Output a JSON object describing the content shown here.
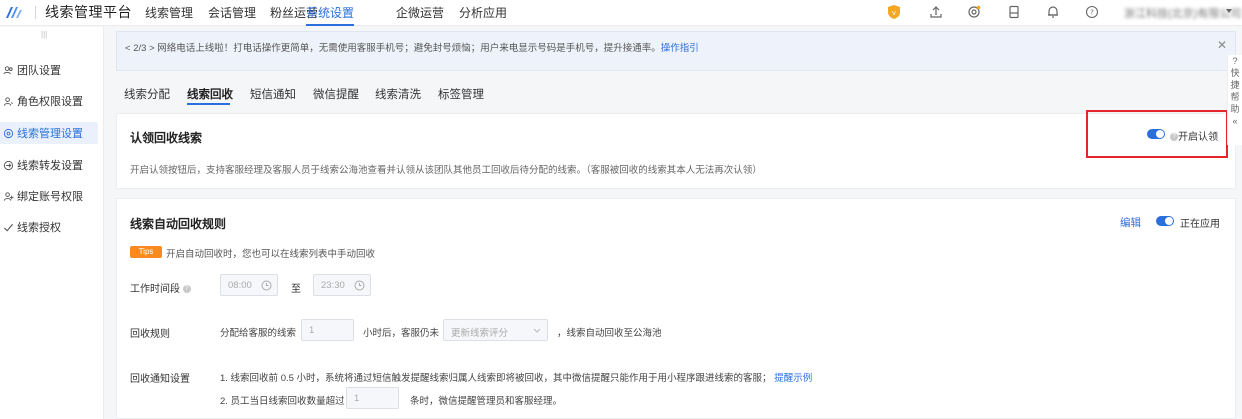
{
  "app": {
    "title": "线索管理平台",
    "user_name": "浙江科技(北京)有限公司"
  },
  "nav": {
    "items": [
      {
        "label": "线索管理"
      },
      {
        "label": "会话管理"
      },
      {
        "label": "粉丝运营"
      },
      {
        "label": "系统设置"
      },
      {
        "label": "企微运营"
      },
      {
        "label": "分析应用"
      }
    ],
    "active_index": 3
  },
  "sidebar": {
    "items": [
      {
        "label": "团队设置",
        "icon": "team-icon"
      },
      {
        "label": "角色权限设置",
        "icon": "user-role-icon"
      },
      {
        "label": "线索管理设置",
        "icon": "clue-settings-icon"
      },
      {
        "label": "线索转发设置",
        "icon": "forward-icon"
      },
      {
        "label": "绑定账号权限",
        "icon": "bind-account-icon"
      },
      {
        "label": "线索授权",
        "icon": "authorize-icon"
      }
    ],
    "active_index": 2
  },
  "notice": {
    "pager": "2/3",
    "text": "网络电话上线啦！打电话操作更简单，无需使用客服手机号；避免封号烦恼；用户来电显示号码是手机号，提升接通率。",
    "link": "操作指引"
  },
  "tabs": {
    "items": [
      {
        "label": "线索分配"
      },
      {
        "label": "线索回收"
      },
      {
        "label": "短信通知"
      },
      {
        "label": "微信提醒"
      },
      {
        "label": "线索清洗"
      },
      {
        "label": "标签管理"
      }
    ],
    "active_index": 1
  },
  "claim_card": {
    "title": "认领回收线索",
    "toggle_label": "开启认领",
    "toggle_on": true,
    "description": "开启认领按钮后，支持客服经理及客服人员于线索公海池查看并认领从该团队其他员工回收后待分配的线索。（客服被回收的线索其本人无法再次认领）"
  },
  "auto_card": {
    "title": "线索自动回收规则",
    "edit_label": "编辑",
    "status_label": "正在应用",
    "status_on": true,
    "tips_tag": "Tips",
    "tips_text": "开启自动回收时，您也可以在线索列表中手动回收",
    "work_hours": {
      "label": "工作时间段",
      "start": "08:00",
      "separator": "至",
      "end": "23:30"
    },
    "recycle_rule": {
      "label": "回收规则",
      "prefix": "分配给客服的线索",
      "hours": "1",
      "middle": "小时后，客服仍未",
      "select_value": "更新线索评分",
      "suffix": "，线索自动回收至公海池"
    },
    "notify": {
      "label": "回收通知设置",
      "line1": "1. 线索回收前 0.5 小时，系统将通过短信触发提醒线索归属人线索即将被回收，其中微信提醒只能作用于用小程序跟进线索的客服；",
      "line1_link": "提醒示例",
      "line2_prefix": "2. 员工当日线索回收数量超过",
      "line2_value": "1",
      "line2_suffix": "条时，微信提醒管理员和客服经理。"
    }
  },
  "right_help": {
    "chars": [
      "快",
      "捷",
      "帮",
      "助"
    ]
  },
  "colors": {
    "accent": "#2a6fdb",
    "tips": "#f98a1e",
    "highlight_box": "#e4262c"
  }
}
